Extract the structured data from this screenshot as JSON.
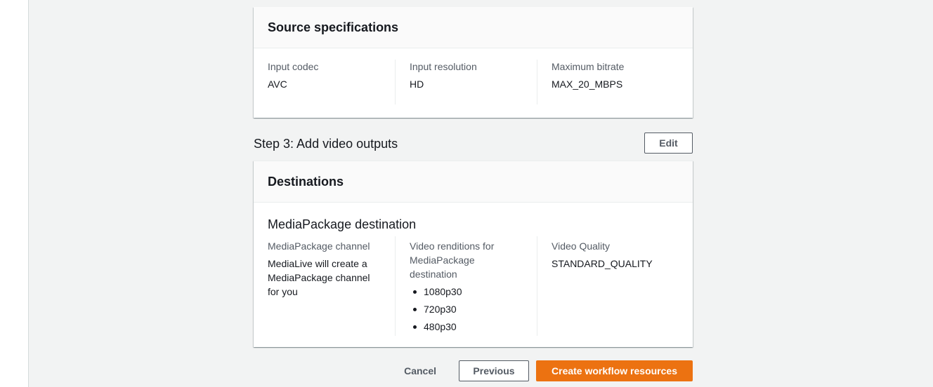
{
  "source_specs": {
    "title": "Source specifications",
    "fields": [
      {
        "label": "Input codec",
        "value": "AVC"
      },
      {
        "label": "Input resolution",
        "value": "HD"
      },
      {
        "label": "Maximum bitrate",
        "value": "MAX_20_MBPS"
      }
    ]
  },
  "step3": {
    "title": "Step 3: Add video outputs",
    "edit_label": "Edit"
  },
  "destinations": {
    "title": "Destinations",
    "subtitle": "MediaPackage destination",
    "channel_label": "MediaPackage channel",
    "channel_value": "MediaLive will create a MediaPackage channel for you",
    "renditions_label": "Video renditions for MediaPackage destination",
    "renditions": [
      "1080p30",
      "720p30",
      "480p30"
    ],
    "quality_label": "Video Quality",
    "quality_value": "STANDARD_QUALITY"
  },
  "actions": {
    "cancel_label": "Cancel",
    "previous_label": "Previous",
    "create_label": "Create workflow resources"
  },
  "colors": {
    "primary": "#ec7211",
    "background": "#f2f3f3",
    "text": "#16191f",
    "label": "#545b64"
  }
}
